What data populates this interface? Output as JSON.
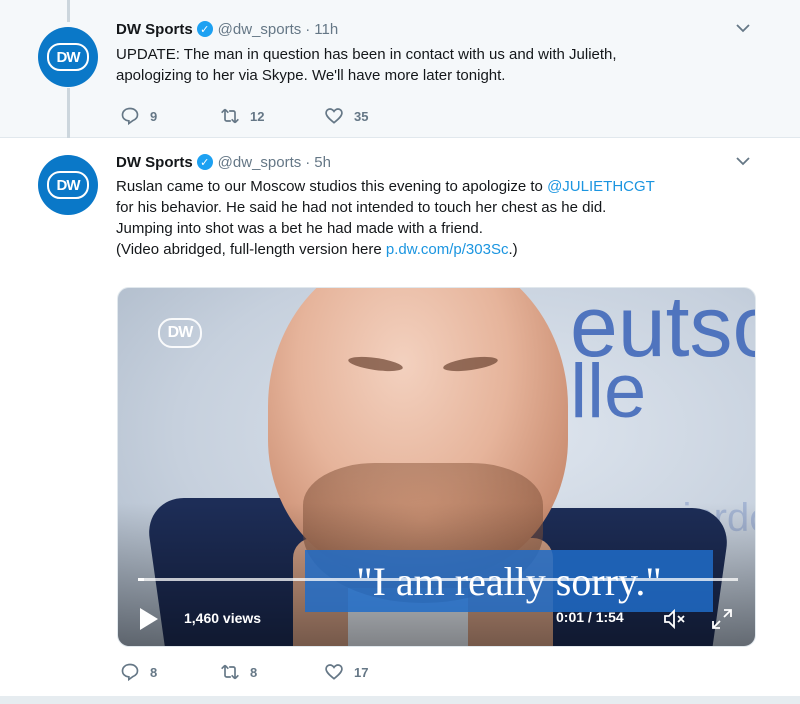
{
  "tweets": [
    {
      "name": "DW Sports",
      "verified": "✓",
      "handle": "@dw_sports",
      "separator": "·",
      "time": "11h",
      "avatar_text": "DW",
      "text_lines": [
        "UPDATE: The man in question has been in contact with us and with Julieth,",
        "apologizing to her via Skype. We'll have more later tonight."
      ],
      "replies": "9",
      "retweets": "12",
      "likes": "35"
    },
    {
      "name": "DW Sports",
      "verified": "✓",
      "handle": "@dw_sports",
      "separator": "·",
      "time": "5h",
      "avatar_text": "DW",
      "text_line1_before": "Ruslan came to our Moscow studios this evening to apologize to ",
      "text_line1_mention": "@JULIETHCGT",
      "text_line2": "for his behavior. He said he had not intended to touch her chest as he did.",
      "text_line3": "Jumping into shot was a bet he had made with a friend.",
      "text_line4_before": "(Video abridged, full-length version here ",
      "text_line4_link": "p.dw.com/p/303Sc",
      "text_line4_after": ".)",
      "video": {
        "logo": "DW",
        "bg_text_1": "eutsch",
        "bg_text_2": "elle",
        "bg_text_3": "eninrdc",
        "caption": "\"I am really sorry.\"",
        "views": "1,460 views",
        "timecode": "0:01 / 1:54",
        "progress_fraction": 0.01
      },
      "replies": "8",
      "retweets": "8",
      "likes": "17"
    }
  ],
  "colors": {
    "accent": "#1da1f2",
    "link": "#1b95e0",
    "muted": "#657786",
    "dw_blue": "#0a78c8"
  },
  "icons": [
    "chevron-down-icon",
    "verified-badge-icon",
    "reply-icon",
    "retweet-icon",
    "like-icon",
    "play-icon",
    "mute-icon",
    "fullscreen-icon"
  ]
}
